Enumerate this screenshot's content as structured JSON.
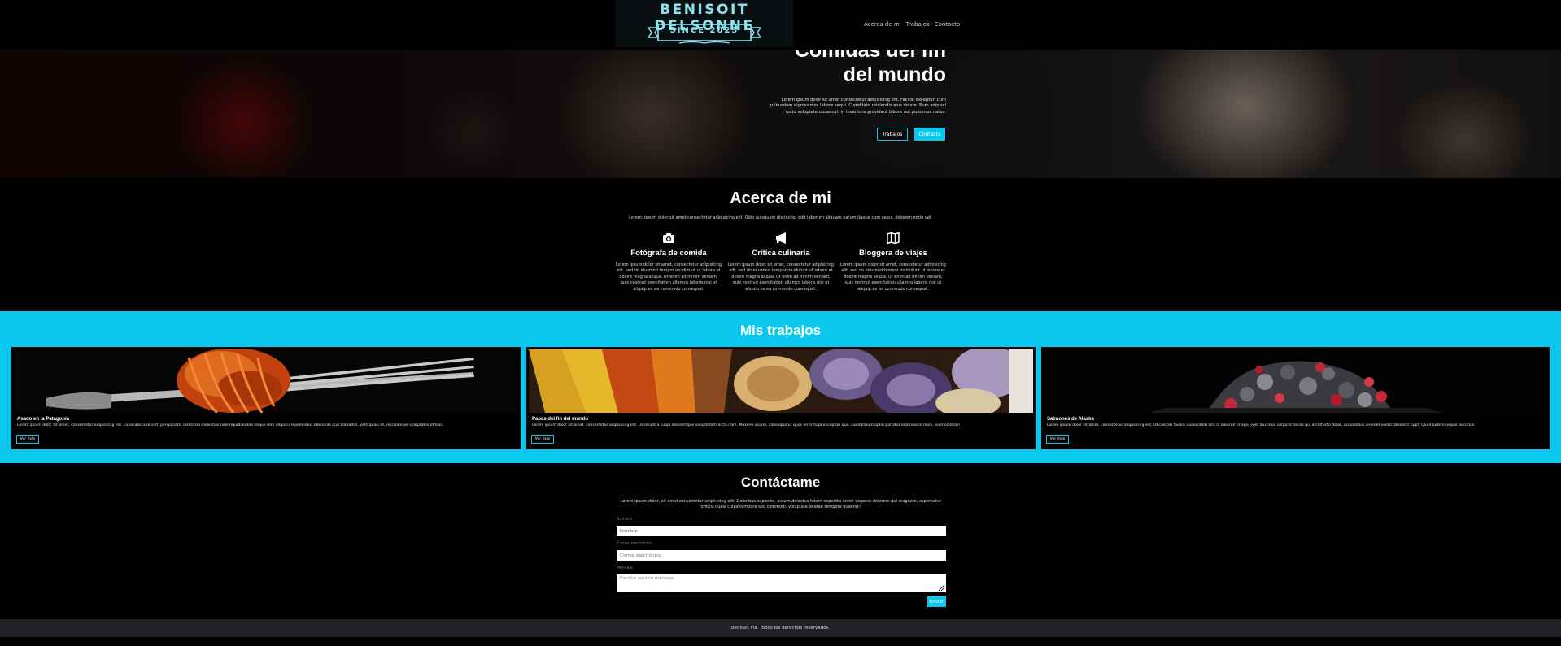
{
  "header": {
    "logo_title": "BENISOIT DELSONNE",
    "logo_since": "SINCE 2023",
    "nav": [
      "Acerca de mi",
      "Trabajos",
      "Contacto"
    ]
  },
  "hero": {
    "title_line1": "Comidas del fin",
    "title_line2": "del mundo",
    "text": "Lorem ipsum dolor sit amet consectetur adipisicing elit. Facilis, excepturi cum quibusdam dignissimos labore sequi. Cupiditate reiciendis eius dolore. Eum adipisci iusto voluptate obcaecati in inventore provident labore aut possimus natus.",
    "btn_outline": "Trabajos",
    "btn_solid": "Contacto"
  },
  "about": {
    "title": "Acerca de mi",
    "intro": "Lorem, ipsum dolor sit amet consectetur adipisicing elit. Odio quisquam distinctio, odit laborum aliquam earum itaque cum sequi, dolorem optio vel.",
    "features": [
      {
        "icon": "camera-icon",
        "title": "Fotógrafa de comida",
        "text": "Lorem ipsum dolor sit amet, consectetur adipisicing elit, sed do eiusmod tempor incididunt ut labore et dolore magna aliqua. Ut enim ad minim veniam, quis nostrud exercitation ullamco laboris nisi ut aliquip ex ea commodo consequat."
      },
      {
        "icon": "megaphone-icon",
        "title": "Crítica culinaria",
        "text": "Lorem ipsum dolor sit amet, consectetur adipisicing elit, sed do eiusmod tempor incididunt ut labore et dolore magna aliqua. Ut enim ad minim veniam, quis nostrud exercitation ullamco laboris nisi ut aliquip ex ea commodo consequat."
      },
      {
        "icon": "map-icon",
        "title": "Bloggera de viajes",
        "text": "Lorem ipsum dolor sit amet, consectetur adipisicing elit, sed do eiusmod tempor incididunt ut labore et dolore magna aliqua. Ut enim ad minim veniam, quis nostrud exercitation ullamco laboris nisi ut aliquip ex ea commodo consequat."
      }
    ]
  },
  "works": {
    "title": "Mis trabajos",
    "cards": [
      {
        "title": "Asado en la Patagonia",
        "text": "Lorem ipsum dolor sit amet, consectetur adipisicing elit. Explicabo iure sint, perspiciatis distinctio molestias nihil repudiandae neque rem adipisci repellendus libero illo quo blanditiis, velit quasi et, recusandae voluptates officiis.",
        "button": "Ver más"
      },
      {
        "title": "Papas del fin del mundo",
        "text": "Lorem ipsum dolor sit amet, consectetur adipisicing elit. Deserunt a culpa doloremque voluptatem dicta nam. Maxime ipsum, consequatur quos error fuga excepturi quo. Laudantium optio pariatur laboriosam modi, ea molestias!",
        "button": "Ver más"
      },
      {
        "title": "Salmones de Alaska",
        "text": "Lorem ipsum dolor sit amet, consectetur adipisicing elit. Obcaecati facere quibusdam sint id laborum magni velit ducimus corporis facilis qui architecto dolor, accusamus eveniet exercitationem fugit. Quod autem neque ducimus.",
        "button": "Ver más"
      }
    ]
  },
  "contact": {
    "title": "Contáctame",
    "intro": "Lorem ipsum dolor, sit amet consectetur adipisicing elit. Doloribus sapiente, autem delectus totam expedita animi corporis dolorem qui magnam, aspernatur officiis quasi culpa tempora sed commodi. Voluptate beatae tempora quaerat?",
    "name_label": "Nombre",
    "name_placeholder": "Nombre",
    "email_label": "Correo electrónico",
    "email_placeholder": "Correo electrónico",
    "message_label": "Mensaje",
    "message_placeholder": "Escribe aquí tu mensaje",
    "send": "Enviar"
  },
  "footer": {
    "text": "Benisoit Fla. Todos los derechos reservados."
  },
  "colors": {
    "accent": "#0bc7ee",
    "background": "#000000",
    "footer": "#202124"
  }
}
